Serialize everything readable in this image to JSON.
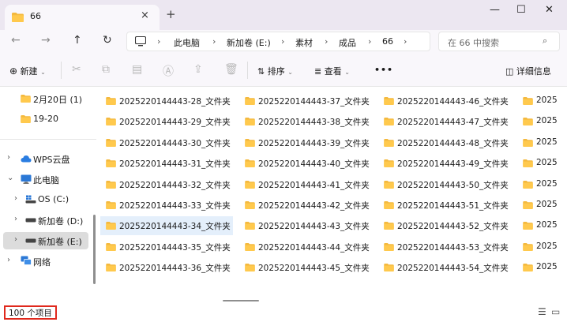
{
  "tab": {
    "title": "66",
    "close": "×",
    "new": "+"
  },
  "window": {
    "minimize": "—",
    "maximize": "☐",
    "close": "✕"
  },
  "nav": {
    "back": "←",
    "forward": "→",
    "up": "↑",
    "refresh": "↻"
  },
  "breadcrumb": [
    {
      "label": "此电脑"
    },
    {
      "label": "新加卷 (E:)"
    },
    {
      "label": "素材"
    },
    {
      "label": "成品"
    },
    {
      "label": "66"
    }
  ],
  "breadcrumb_sep": "›",
  "search": {
    "placeholder": "在 66 中搜索",
    "icon": "⌕"
  },
  "toolbar": {
    "new_label": "新建",
    "sort_label": "排序",
    "view_label": "查看",
    "more": "•••",
    "details_label": "详细信息",
    "icons": [
      "cut-icon",
      "copy-icon",
      "paste-icon",
      "rename-icon",
      "share-icon",
      "delete-icon"
    ]
  },
  "sidebar": {
    "items": [
      {
        "label": "2月20日 (1)",
        "icon": "folder-icon"
      },
      {
        "label": "19-20",
        "icon": "folder-icon"
      },
      {
        "label": "WPS云盘",
        "icon": "cloud-icon"
      },
      {
        "label": "此电脑",
        "icon": "computer-icon"
      },
      {
        "label": "OS (C:)",
        "icon": "drive-icon"
      },
      {
        "label": "新加卷 (D:)",
        "icon": "drive-icon"
      },
      {
        "label": "新加卷 (E:)",
        "icon": "drive-icon"
      },
      {
        "label": "网络",
        "icon": "network-icon"
      }
    ]
  },
  "files": {
    "col1": [
      "2025220144443-28_文件夹",
      "2025220144443-29_文件夹",
      "2025220144443-30_文件夹",
      "2025220144443-31_文件夹",
      "2025220144443-32_文件夹",
      "2025220144443-33_文件夹",
      "2025220144443-34_文件夹",
      "2025220144443-35_文件夹",
      "2025220144443-36_文件夹"
    ],
    "col2": [
      "2025220144443-37_文件夹",
      "2025220144443-38_文件夹",
      "2025220144443-39_文件夹",
      "2025220144443-40_文件夹",
      "2025220144443-41_文件夹",
      "2025220144443-42_文件夹",
      "2025220144443-43_文件夹",
      "2025220144443-44_文件夹",
      "2025220144443-45_文件夹"
    ],
    "col3": [
      "2025220144443-46_文件夹",
      "2025220144443-47_文件夹",
      "2025220144443-48_文件夹",
      "2025220144443-49_文件夹",
      "2025220144443-50_文件夹",
      "2025220144443-51_文件夹",
      "2025220144443-52_文件夹",
      "2025220144443-53_文件夹",
      "2025220144443-54_文件夹"
    ],
    "col4": [
      "2025",
      "2025",
      "2025",
      "2025",
      "2025",
      "2025",
      "2025",
      "2025",
      "2025"
    ]
  },
  "status": {
    "count": "100 个项目"
  },
  "colors": {
    "folder": "#f4b93e",
    "highlight": "#e0281c",
    "selection": "#e4effb"
  }
}
